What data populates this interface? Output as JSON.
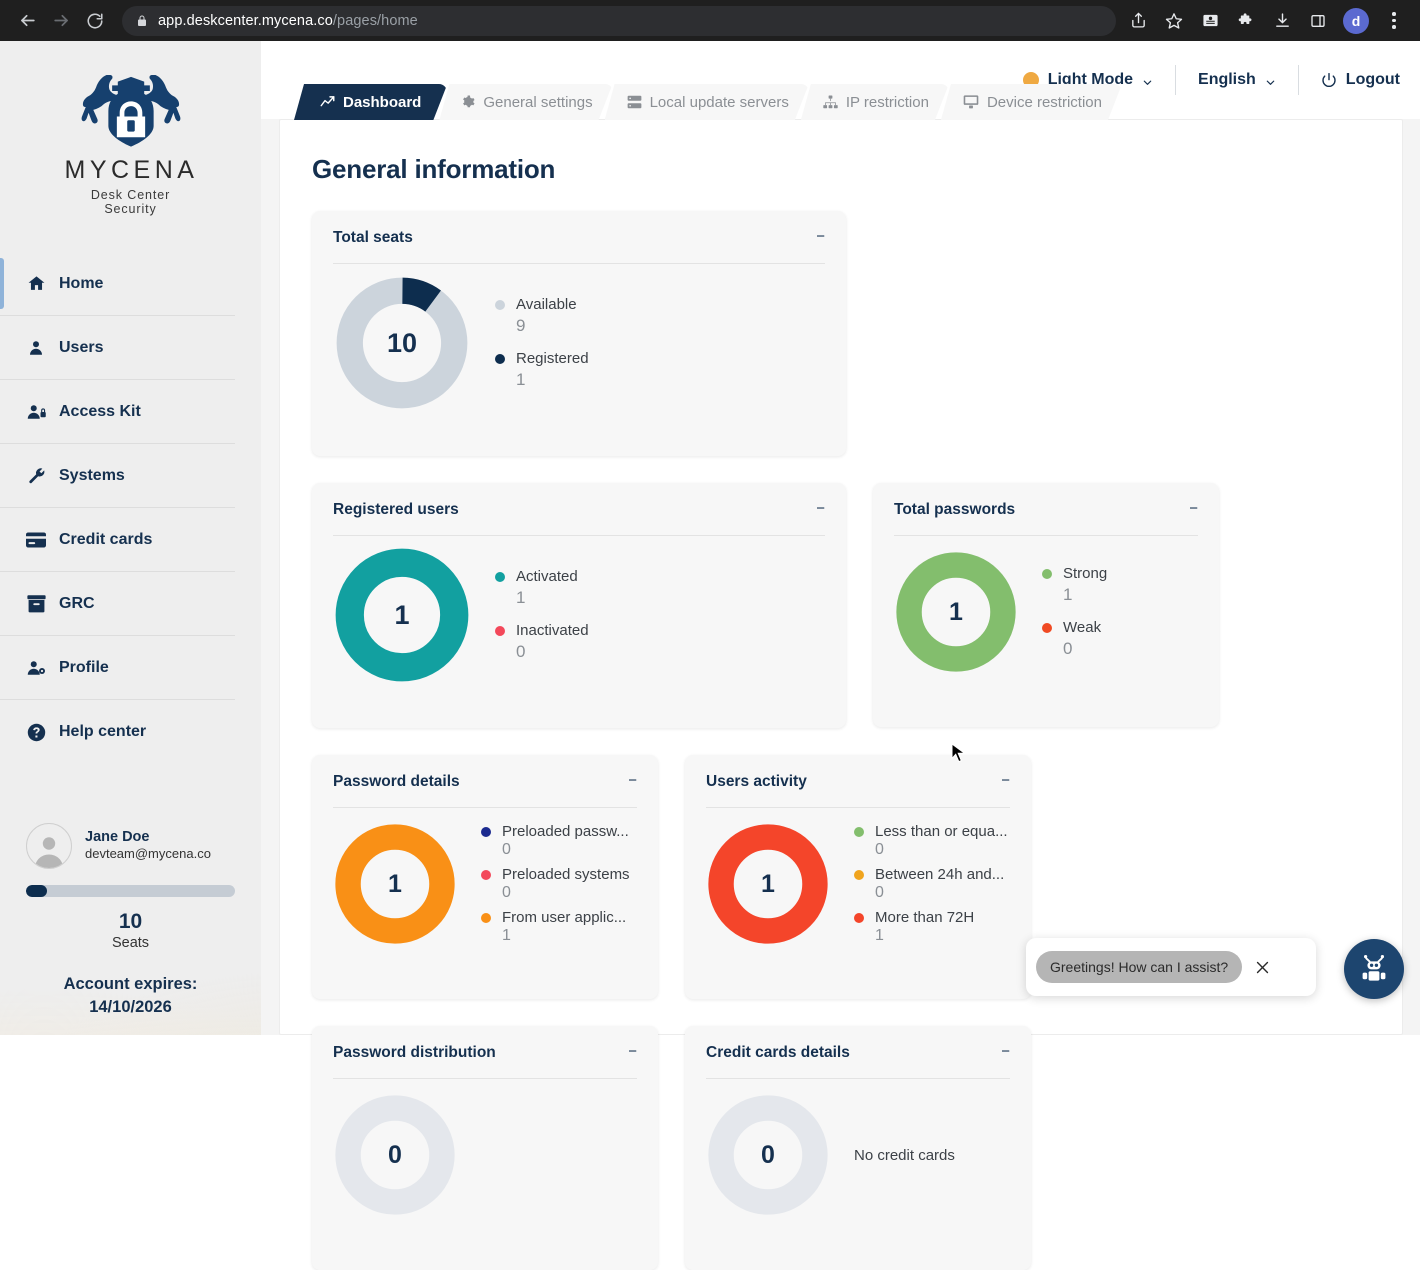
{
  "browser": {
    "url_domain": "app.deskcenter.mycena.co",
    "url_path": "/pages/home",
    "back_icon": "back-arrow-icon",
    "forward_icon": "forward-arrow-icon",
    "reload_icon": "reload-icon",
    "lock_icon": "lock-icon",
    "share_icon": "share-icon",
    "bookmark_icon": "star-icon",
    "reading_icon": "reading-list-icon",
    "extensions_icon": "puzzle-icon",
    "downloads_icon": "download-icon",
    "sidepanel_icon": "side-panel-icon",
    "profile_initial": "d",
    "menu_icon": "kebab-menu-icon"
  },
  "sidebar": {
    "logo_word": "MYCENA",
    "logo_sub": "Desk Center Security",
    "items": [
      {
        "label": "Home",
        "icon": "home-icon",
        "active": true
      },
      {
        "label": "Users",
        "icon": "user-icon",
        "active": false
      },
      {
        "label": "Access Kit",
        "icon": "user-key-icon",
        "active": false
      },
      {
        "label": "Systems",
        "icon": "wrench-icon",
        "active": false
      },
      {
        "label": "Credit cards",
        "icon": "credit-card-icon",
        "active": false
      },
      {
        "label": "GRC",
        "icon": "archive-icon",
        "active": false
      },
      {
        "label": "Profile",
        "icon": "user-gear-icon",
        "active": false
      },
      {
        "label": "Help center",
        "icon": "question-circle-icon",
        "active": false
      }
    ],
    "user": {
      "name": "Jane Doe",
      "email": "devteam@mycena.co",
      "avatar_icon": "avatar-placeholder-icon"
    },
    "seats": {
      "count": "10",
      "label": "Seats",
      "used_percent": 10
    },
    "account": {
      "expires_label": "Account expires:",
      "expires_date": "14/10/2026"
    }
  },
  "topbar": {
    "mode_label": "Light Mode",
    "mode_color": "#efa942",
    "language_label": "English",
    "logout_label": "Logout",
    "power_icon": "power-icon",
    "chevron_icon": "chevron-down-icon"
  },
  "tabs": [
    {
      "label": "Dashboard",
      "icon": "chart-line-icon",
      "active": true
    },
    {
      "label": "General settings",
      "icon": "gear-icon",
      "active": false
    },
    {
      "label": "Local update servers",
      "icon": "server-icon",
      "active": false
    },
    {
      "label": "IP restriction",
      "icon": "network-icon",
      "active": false
    },
    {
      "label": "Device restriction",
      "icon": "monitor-icon",
      "active": false
    }
  ],
  "page": {
    "title": "General information",
    "minimize_glyph": "−"
  },
  "chart_data": [
    {
      "type": "pie",
      "title": "Total seats",
      "center_value": "10",
      "labels": [
        "Available",
        "Registered"
      ],
      "values": [
        9,
        1
      ],
      "value_labels": [
        "9",
        "1"
      ],
      "colors": [
        "#ccd4dc",
        "#0d2d4e"
      ],
      "legend": "right",
      "donut": true
    },
    {
      "type": "pie",
      "title": "Registered users",
      "center_value": "1",
      "labels": [
        "Activated",
        "Inactivated"
      ],
      "values": [
        1,
        0
      ],
      "value_labels": [
        "1",
        "0"
      ],
      "colors": [
        "#12a0a0",
        "#f3485a"
      ],
      "legend": "right",
      "donut": true
    },
    {
      "type": "pie",
      "title": "Total passwords",
      "center_value": "1",
      "labels": [
        "Strong",
        "Weak"
      ],
      "values": [
        1,
        0
      ],
      "value_labels": [
        "1",
        "0"
      ],
      "colors": [
        "#83be6d",
        "#f04a23"
      ],
      "legend": "right",
      "donut": true
    },
    {
      "type": "pie",
      "title": "Password details",
      "center_value": "1",
      "labels": [
        "Preloaded passw...",
        "Preloaded systems",
        "From user applic..."
      ],
      "values": [
        0,
        0,
        1
      ],
      "value_labels": [
        "0",
        "0",
        "1"
      ],
      "colors": [
        "#1b2a8f",
        "#f3485a",
        "#f99016"
      ],
      "legend": "right",
      "donut": true
    },
    {
      "type": "pie",
      "title": "Users activity",
      "center_value": "1",
      "labels": [
        "Less than or equa...",
        "Between 24h and...",
        "More than 72H"
      ],
      "values": [
        0,
        0,
        1
      ],
      "value_labels": [
        "0",
        "0",
        "1"
      ],
      "colors": [
        "#83be6d",
        "#f0a41e",
        "#f4452a"
      ],
      "legend": "right",
      "donut": true
    },
    {
      "type": "pie",
      "title": "Password distribution",
      "center_value": "0",
      "labels": [],
      "values": [],
      "value_labels": [],
      "colors": [
        "#e4e7ec"
      ],
      "legend": "none",
      "donut": true
    },
    {
      "type": "pie",
      "title": "Credit cards details",
      "center_value": "0",
      "labels": [],
      "values": [],
      "value_labels": [],
      "colors": [
        "#e4e7ec"
      ],
      "legend": "right",
      "empty_note": "No credit cards",
      "donut": true
    }
  ],
  "chat": {
    "message": "Greetings! How can I assist?",
    "close_icon": "close-icon",
    "bot_icon": "robot-icon"
  }
}
